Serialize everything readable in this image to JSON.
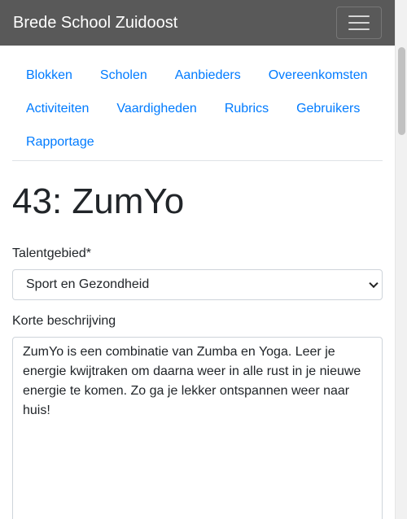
{
  "navbar": {
    "brand": "Brede School Zuidoost",
    "toggle_icon": "hamburger-menu-icon"
  },
  "nav": {
    "items": [
      {
        "label": "Blokken"
      },
      {
        "label": "Scholen"
      },
      {
        "label": "Aanbieders"
      },
      {
        "label": "Overeenkomsten"
      },
      {
        "label": "Activiteiten"
      },
      {
        "label": "Vaardigheden"
      },
      {
        "label": "Rubrics"
      },
      {
        "label": "Gebruikers"
      },
      {
        "label": "Rapportage"
      }
    ]
  },
  "page": {
    "title": "43: ZumYo"
  },
  "form": {
    "talentgebied": {
      "label": "Talentgebied*",
      "value": "Sport en Gezondheid"
    },
    "beschrijving": {
      "label": "Korte beschrijving",
      "value": "ZumYo is een combinatie van Zumba en Yoga. Leer je energie kwijtraken om daarna weer in alle rust in je nieuwe energie te komen. Zo ga je lekker ontspannen weer naar huis!"
    }
  },
  "colors": {
    "navbar_bg": "#595959",
    "link": "#007bff"
  }
}
